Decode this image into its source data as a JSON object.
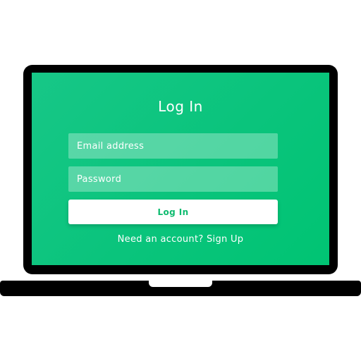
{
  "login": {
    "title": "Log In",
    "email_placeholder": "Email address",
    "password_placeholder": "Password",
    "submit_label": "Log In",
    "signup_prompt": "Need an account? ",
    "signup_link": "Sign Up"
  },
  "colors": {
    "screen_green": "#0ac47c",
    "button_text_green": "#0dbb6f",
    "device_black": "#000000"
  }
}
